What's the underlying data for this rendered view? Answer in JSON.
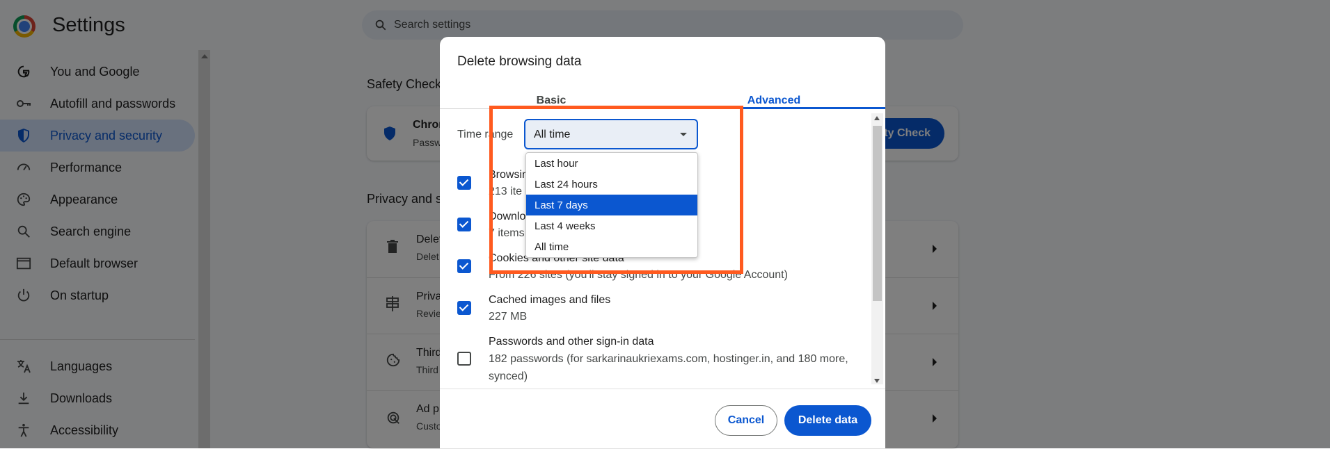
{
  "app": {
    "title": "Settings"
  },
  "search": {
    "placeholder": "Search settings"
  },
  "sidebar": {
    "items": [
      {
        "label": "You and Google",
        "icon": "google-g-icon"
      },
      {
        "label": "Autofill and passwords",
        "icon": "key-icon"
      },
      {
        "label": "Privacy and security",
        "icon": "shield-icon",
        "active": true
      },
      {
        "label": "Performance",
        "icon": "speedometer-icon"
      },
      {
        "label": "Appearance",
        "icon": "palette-icon"
      },
      {
        "label": "Search engine",
        "icon": "search-icon"
      },
      {
        "label": "Default browser",
        "icon": "browser-window-icon"
      },
      {
        "label": "On startup",
        "icon": "power-icon"
      },
      {
        "label": "Languages",
        "icon": "translate-icon"
      },
      {
        "label": "Downloads",
        "icon": "download-icon"
      },
      {
        "label": "Accessibility",
        "icon": "accessibility-icon"
      }
    ]
  },
  "main": {
    "safety_check_heading": "Safety Check",
    "safety_card_title": "Chron",
    "safety_card_sub": "Passw",
    "safety_check_button": "ety Check",
    "privacy_heading": "Privacy and s",
    "rows": [
      {
        "title": "Delet",
        "sub": "Delet",
        "icon": "trash-icon"
      },
      {
        "title": "Priva",
        "sub": "Revie",
        "icon": "signpost-icon"
      },
      {
        "title": "Third",
        "sub": "Third",
        "icon": "cookie-icon"
      },
      {
        "title": "Ad p",
        "sub": "Custo",
        "icon": "ad-privacy-icon"
      }
    ]
  },
  "dialog": {
    "title": "Delete browsing data",
    "tabs": {
      "basic": "Basic",
      "advanced": "Advanced"
    },
    "time_range": {
      "label": "Time range",
      "value": "All time",
      "options": [
        "Last hour",
        "Last 24 hours",
        "Last 7 days",
        "Last 4 weeks",
        "All time"
      ],
      "highlighted_option": "Last 7 days"
    },
    "items": [
      {
        "title": "Browsin",
        "sub": "213 ite",
        "checked": true
      },
      {
        "title": "Downlo",
        "sub": "7 items",
        "checked": true
      },
      {
        "title": "Cookies and other site data",
        "sub": "From 226 sites (you'll stay signed in to your Google Account)",
        "checked": true
      },
      {
        "title": "Cached images and files",
        "sub": "227 MB",
        "checked": true
      },
      {
        "title": "Passwords and other sign-in data",
        "sub": "182 passwords (for sarkarinaukriexams.com, hostinger.in, and 180 more, synced)",
        "checked": false
      }
    ],
    "buttons": {
      "cancel": "Cancel",
      "delete": "Delete data"
    }
  },
  "colors": {
    "accent": "#0b57d0",
    "highlight_box": "#ff5a1f"
  }
}
